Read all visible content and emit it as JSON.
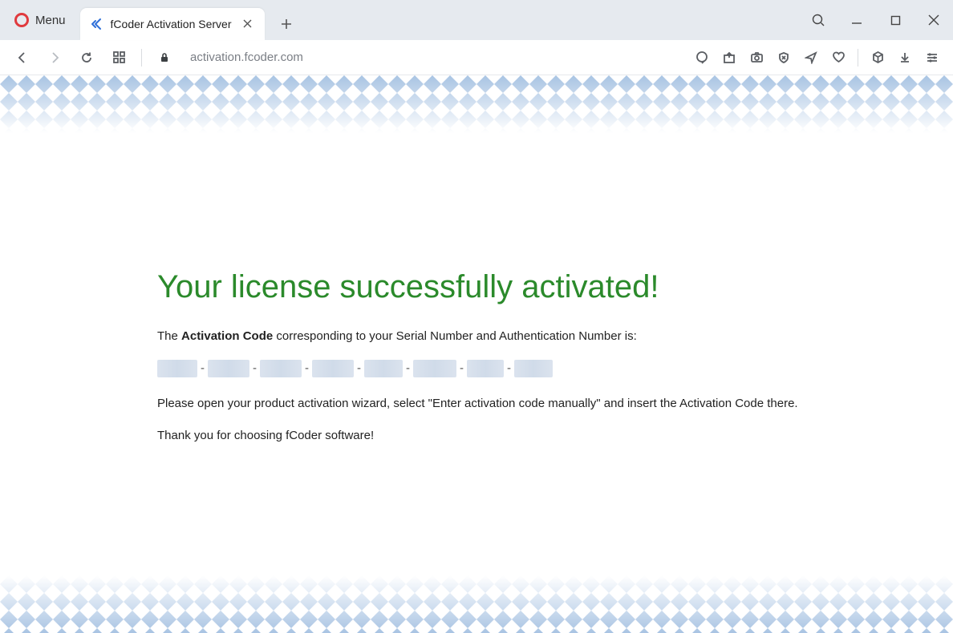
{
  "browser": {
    "menu_label": "Menu",
    "tab_title": "fCoder Activation Server",
    "url": "activation.fcoder.com"
  },
  "page": {
    "heading": "Your license successfully activated!",
    "intro_prefix": "The ",
    "intro_bold": "Activation Code",
    "intro_suffix": " corresponding to your Serial Number and Authentication Number is:",
    "code_segment_widths": [
      50,
      52,
      52,
      52,
      48,
      54,
      46,
      48
    ],
    "instruction": "Please open your product activation wizard, select \"Enter activation code manually\" and insert the Activation Code there.",
    "thanks": "Thank you for choosing fCoder software!"
  }
}
